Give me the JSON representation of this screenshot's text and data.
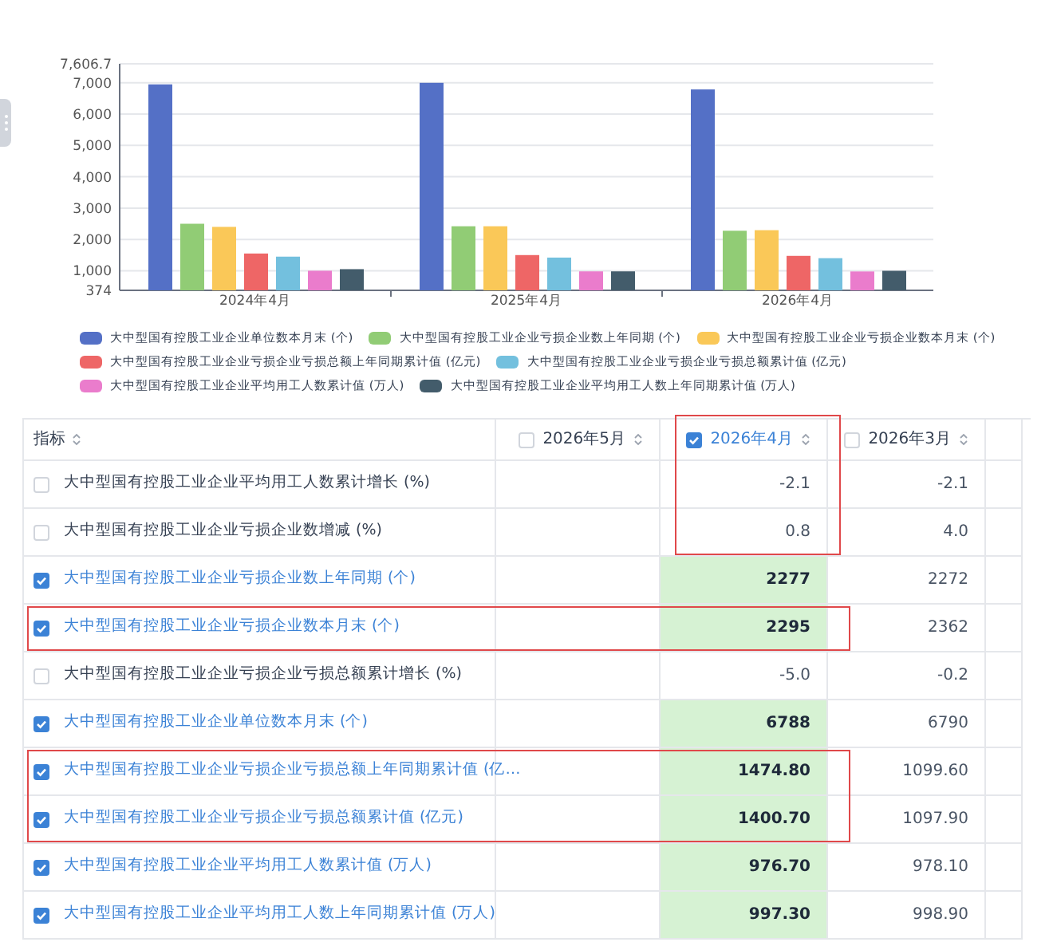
{
  "chart": {
    "chart_data": {
      "type": "bar",
      "categories": [
        "2024年4月",
        "2025年4月",
        "2026年4月"
      ],
      "ylim": [
        374,
        7606.7
      ],
      "grid": true,
      "yticks": [
        374,
        {
          "value": 1000,
          "label": "1,000"
        },
        {
          "value": 2000,
          "label": "2,000"
        },
        {
          "value": 3000,
          "label": "3,000"
        },
        {
          "value": 4000,
          "label": "4,000"
        },
        {
          "value": 5000,
          "label": "5,000"
        },
        {
          "value": 6000,
          "label": "6,000"
        },
        {
          "value": 7000,
          "label": "7,000"
        },
        {
          "value": 7606.7,
          "label": "7,606.7"
        }
      ],
      "series": [
        {
          "name": "大中型国有控股工业企业单位数本月末 (个)",
          "color": "#5470c6",
          "values": [
            6950,
            7000,
            6788
          ]
        },
        {
          "name": "大中型国有控股工业企业亏损企业数上年同期 (个)",
          "color": "#91cc75",
          "values": [
            2500,
            2420,
            2277
          ]
        },
        {
          "name": "大中型国有控股工业企业亏损企业数本月末 (个)",
          "color": "#fac858",
          "values": [
            2400,
            2420,
            2295
          ]
        },
        {
          "name": "大中型国有控股工业企业亏损企业亏损总额上年同期累计值 (亿元)",
          "color": "#ee6666",
          "values": [
            1550,
            1500,
            1474.8
          ]
        },
        {
          "name": "大中型国有控股工业企业亏损企业亏损总额累计值 (亿元)",
          "color": "#73c0de",
          "values": [
            1450,
            1420,
            1400.7
          ]
        },
        {
          "name": "大中型国有控股工业企业平均用工人数累计值 (万人)",
          "color": "#ea7ccc",
          "values": [
            1000,
            980,
            976.7
          ]
        },
        {
          "name": "大中型国有控股工业企业平均用工人数上年同期累计值 (万人)",
          "color": "#435c6b",
          "values": [
            1050,
            980,
            997.3
          ]
        }
      ]
    }
  },
  "table": {
    "indicator_header": "指标",
    "columns": [
      {
        "label": "2026年5月",
        "checked": false,
        "framed": false
      },
      {
        "label": "2026年4月",
        "checked": true,
        "framed": true
      },
      {
        "label": "2026年3月",
        "checked": false,
        "framed": false
      }
    ],
    "rows": [
      {
        "label": "大中型国有控股工业企业平均用工人数累计增长 (%)",
        "checked": false,
        "framed": false,
        "column_frame": true,
        "values": [
          "-2.1",
          "-2.1"
        ]
      },
      {
        "label": "大中型国有控股工业企业亏损企业数增减 (%)",
        "checked": false,
        "framed": false,
        "column_frame": true,
        "values": [
          "0.8",
          "4.0"
        ]
      },
      {
        "label": "大中型国有控股工业企业亏损企业数上年同期 (个)",
        "checked": true,
        "framed": false,
        "column_frame": false,
        "values": [
          "2277",
          "2272"
        ]
      },
      {
        "label": "大中型国有控股工业企业亏损企业数本月末 (个)",
        "checked": true,
        "framed": true,
        "column_frame": false,
        "values": [
          "2295",
          "2362"
        ]
      },
      {
        "label": "大中型国有控股工业企业亏损企业亏损总额累计增长 (%)",
        "checked": false,
        "framed": false,
        "column_frame": false,
        "values": [
          "-5.0",
          "-0.2"
        ]
      },
      {
        "label": "大中型国有控股工业企业单位数本月末 (个)",
        "checked": true,
        "framed": false,
        "column_frame": false,
        "values": [
          "6788",
          "6790"
        ]
      },
      {
        "label": "大中型国有控股工业企业亏损企业亏损总额上年同期累计值 (亿…",
        "checked": true,
        "framed": true,
        "column_frame": false,
        "values": [
          "1474.80",
          "1099.60"
        ]
      },
      {
        "label": "大中型国有控股工业企业亏损企业亏损总额累计值 (亿元)",
        "checked": true,
        "framed": true,
        "column_frame": false,
        "values": [
          "1400.70",
          "1097.90"
        ]
      },
      {
        "label": "大中型国有控股工业企业平均用工人数累计值 (万人)",
        "checked": true,
        "framed": false,
        "column_frame": false,
        "values": [
          "976.70",
          "978.10"
        ]
      },
      {
        "label": "大中型国有控股工业企业平均用工人数上年同期累计值 (万人)",
        "checked": true,
        "framed": false,
        "column_frame": false,
        "values": [
          "997.30",
          "998.90"
        ]
      }
    ]
  }
}
